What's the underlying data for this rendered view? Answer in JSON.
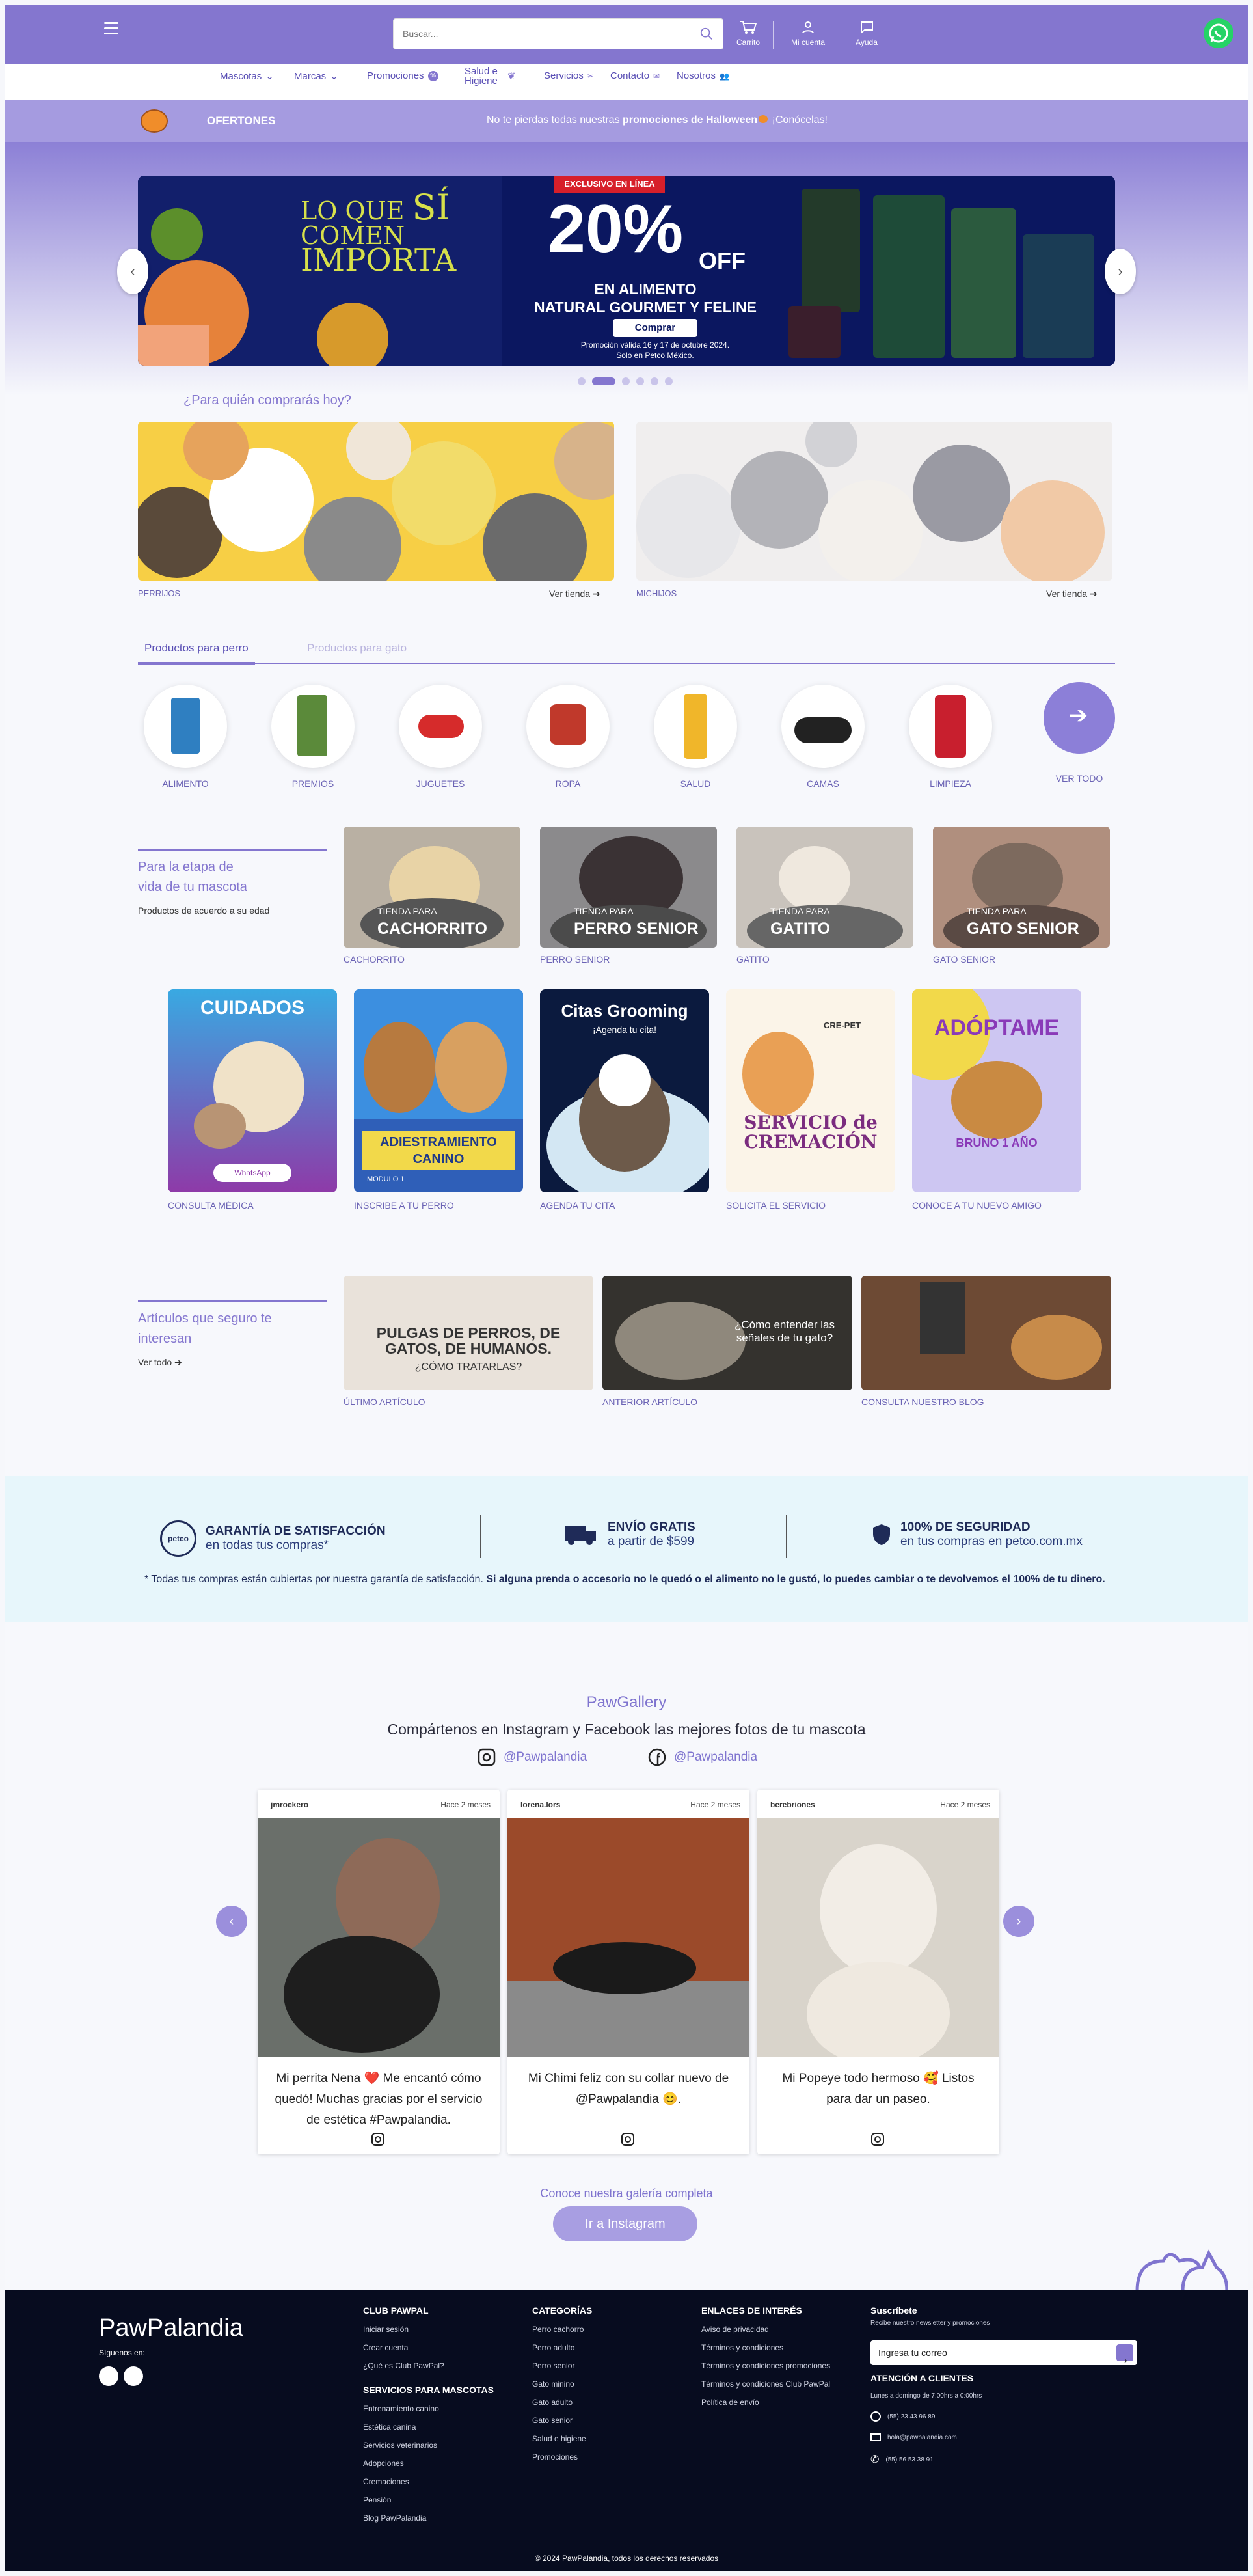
{
  "header": {
    "search_placeholder": "Buscar...",
    "cart": "Carrito",
    "account": "Mi cuenta",
    "help": "Ayuda"
  },
  "nav": [
    {
      "label": "Mascotas"
    },
    {
      "label": "Marcas"
    },
    {
      "label": "Promociones"
    },
    {
      "label": "Salud e Higiene"
    },
    {
      "label": "Servicios"
    },
    {
      "label": "Contacto"
    },
    {
      "label": "Nosotros"
    }
  ],
  "offer": {
    "label": "OFERTONES",
    "message_pre": "No te pierdas todas nuestras ",
    "message_bold": "promociones de Halloween",
    "message_post": " ¡Conócelas!"
  },
  "banner": {
    "tag": "EXCLUSIVO EN LÍNEA",
    "slogan_1": "LO QUE",
    "slogan_2": "SÍ",
    "slogan_3": "COMEN",
    "slogan_4": "IMPORTA",
    "percent": "20%",
    "off": "OFF",
    "line1": "EN ALIMENTO",
    "line2": "NATURAL GOURMET Y FELINE",
    "button": "Comprar",
    "note1": "Promoción válida 16 y 17 de octubre 2024.",
    "note2": "Solo en Petco México."
  },
  "who": {
    "title": "¿Para quién comprarás hoy?",
    "dogs_label": "PERRIJOS",
    "cats_label": "MICHIJOS",
    "link": "Ver tienda"
  },
  "tabs": {
    "active": "Productos para perro",
    "inactive": "Productos para gato"
  },
  "categories": [
    {
      "label": "ALIMENTO"
    },
    {
      "label": "PREMIOS"
    },
    {
      "label": "JUGUETES"
    },
    {
      "label": "ROPA"
    },
    {
      "label": "SALUD"
    },
    {
      "label": "CAMAS"
    },
    {
      "label": "LIMPIEZA"
    },
    {
      "label": "VER TODO"
    }
  ],
  "stages": {
    "title": "Para la etapa de vida de tu mascota",
    "subtitle": "Productos de acuerdo a su edad",
    "items": [
      {
        "small": "TIENDA PARA",
        "big": "CACHORRITO",
        "label": "CACHORRITO"
      },
      {
        "small": "TIENDA PARA",
        "big": "PERRO SENIOR",
        "label": "PERRO SENIOR"
      },
      {
        "small": "TIENDA PARA",
        "big": "GATITO",
        "label": "GATITO"
      },
      {
        "small": "TIENDA PARA",
        "big": "GATO SENIOR",
        "label": "GATO SENIOR"
      }
    ]
  },
  "services": [
    {
      "head": "CUIDADOS",
      "label": "CONSULTA MÉDICA",
      "extra": "WhatsApp"
    },
    {
      "head": "ADIESTRAMIENTO CANINO",
      "label": "INSCRIBE A TU PERRO",
      "extra": "MODULO 1"
    },
    {
      "head": "Citas Grooming",
      "label": "AGENDA TU CITA",
      "extra": "¡Agenda tu cita!"
    },
    {
      "head": "SERVICIO de CREMACIÓN",
      "label": "SOLICITA EL SERVICIO",
      "extra": "CRE-PET"
    },
    {
      "head": "ADÓPTAME",
      "label": "CONOCE A TU NUEVO AMIGO",
      "extra": "BRUNO 1 AÑO"
    }
  ],
  "articles": {
    "title": "Artículos que seguro te interesan",
    "link": "Ver todo",
    "items": [
      {
        "text": "PULGAS DE PERROS, DE GATOS, DE HUMANOS.",
        "sub": "¿CÓMO TRATARLAS?",
        "label": "ÚLTIMO ARTÍCULO"
      },
      {
        "text": "¿Cómo entender las señales de tu gato?",
        "sub": "",
        "label": "ANTERIOR ARTÍCULO"
      },
      {
        "text": "",
        "sub": "",
        "label": "CONSULTA NUESTRO BLOG"
      }
    ]
  },
  "guarantees": [
    {
      "title": "GARANTÍA DE SATISFACCIÓN",
      "sub": "en todas tus compras*"
    },
    {
      "title": "ENVÍO GRATIS",
      "sub": "a partir de $599"
    },
    {
      "title": "100% DE SEGURIDAD",
      "sub": "en tus compras en petco.com.mx"
    }
  ],
  "guarantee_note_pre": "* Todas tus compras están cubiertas por nuestra garantía de satisfacción. ",
  "guarantee_note_bold": "Si alguna prenda o accesorio no le quedó o el alimento no le gustó, lo puedes cambiar o te devolvemos el 100% de tu dinero.",
  "gallery": {
    "title": "PawGallery",
    "subtitle": "Compártenos en Instagram y Facebook las mejores fotos de tu mascota",
    "instagram": "@Pawpalandia",
    "facebook": "@Pawpalandia",
    "posts": [
      {
        "user": "jmrockero",
        "time": "Hace 2 meses",
        "caption": "Mi perrita Nena ❤️ Me encantó cómo quedó! Muchas gracias por el servicio de estética #Pawpalandia."
      },
      {
        "user": "lorena.lors",
        "time": "Hace 2 meses",
        "caption": "Mi Chimi feliz con su collar nuevo de @Pawpalandia 😊."
      },
      {
        "user": "berebriones",
        "time": "Hace 2 meses",
        "caption": "Mi Popeye todo hermoso 🥰 Listos para dar un paseo."
      }
    ],
    "more": "Conoce nuestra galería completa",
    "button": "Ir a Instagram"
  },
  "footer": {
    "brand": "PawPalandia",
    "follow": "Síguenos en:",
    "club_title": "CLUB PAWPAL",
    "club": [
      "Iniciar sesión",
      "Crear cuenta",
      "¿Qué es Club PawPal?"
    ],
    "services_title": "SERVICIOS PARA MASCOTAS",
    "services": [
      "Entrenamiento canino",
      "Estética canina",
      "Servicios veterinarios",
      "Adopciones",
      "Cremaciones",
      "Pensión",
      "Blog PawPalandia"
    ],
    "cats_title": "CATEGORÍAS",
    "cats": [
      "Perro cachorro",
      "Perro adulto",
      "Perro senior",
      "Gato minino",
      "Gato adulto",
      "Gato senior",
      "Salud e higiene",
      "Promociones"
    ],
    "links_title": "ENLACES DE INTERÉS",
    "links": [
      "Aviso de privacidad",
      "Términos y condiciones",
      "Términos y condiciones promociones",
      "Términos y condiciones Club PawPal",
      "Política de envío"
    ],
    "sub_title": "Suscríbete",
    "sub_text": "Recibe nuestro newsletter y promociones",
    "sub_placeholder": "Ingresa tu correo",
    "attention_title": "ATENCIÓN A CLIENTES",
    "hours": "Lunes a domingo de 7:00hrs a 0:00hrs",
    "phone1": "(55) 23 43 96 89",
    "email": "hola@pawpalandia.com",
    "phone2": "(55) 56 53 38 91",
    "copyright": "© 2024 PawPalandia, todos los derechos reservados"
  },
  "colors": {
    "primary": "#8476cf",
    "dark": "#070c1f",
    "accent_light": "#e7f6fb"
  }
}
